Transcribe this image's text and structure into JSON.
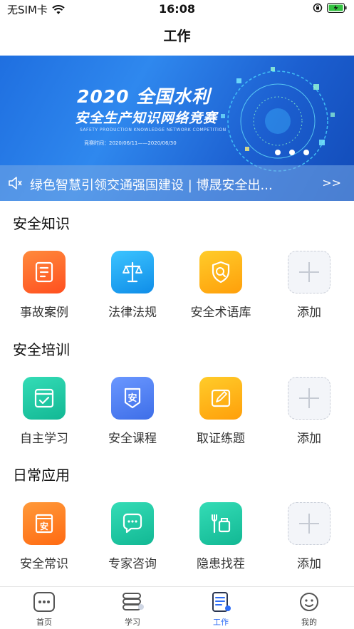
{
  "status": {
    "carrier": "无SIM卡",
    "time": "16:08"
  },
  "nav": {
    "title": "工作"
  },
  "banner": {
    "title1": "2020 全国水利",
    "title2": "安全生产知识网络竞赛",
    "subtitle": "SAFETY PRODUCTION KNOWLEDGE NETWORK COMPETITION",
    "date": "竞赛时间：2020/06/11——2020/06/30",
    "active_dot": 0,
    "dot_count": 3
  },
  "notice": {
    "text": "绿色智慧引领交通强国建设 | 博晟安全出...",
    "more": ">>"
  },
  "sections": [
    {
      "title": "安全知识",
      "items": [
        {
          "label": "事故案例",
          "icon": "case-file-icon",
          "color": "#ff6a2b"
        },
        {
          "label": "法律法规",
          "icon": "scales-icon",
          "color": "#1fa8f0"
        },
        {
          "label": "安全术语库",
          "icon": "search-shield-icon",
          "color": "#ffb514"
        },
        {
          "label": "添加",
          "icon": "plus-icon",
          "color": "#f3f5f9"
        }
      ]
    },
    {
      "title": "安全培训",
      "items": [
        {
          "label": "自主学习",
          "icon": "self-study-icon",
          "color": "#1ec9a6"
        },
        {
          "label": "安全课程",
          "icon": "course-shield-icon",
          "color": "#4a7df0"
        },
        {
          "label": "取证练题",
          "icon": "exam-edit-icon",
          "color": "#ffb514"
        },
        {
          "label": "添加",
          "icon": "plus-icon",
          "color": "#f3f5f9"
        }
      ]
    },
    {
      "title": "日常应用",
      "items": [
        {
          "label": "安全常识",
          "icon": "safety-knowledge-icon",
          "color": "#ff7a1f"
        },
        {
          "label": "专家咨询",
          "icon": "chat-bubble-icon",
          "color": "#1ec9a6"
        },
        {
          "label": "隐患找茬",
          "icon": "wrench-tools-icon",
          "color": "#1ec9a6"
        },
        {
          "label": "添加",
          "icon": "plus-icon",
          "color": "#f3f5f9"
        }
      ]
    }
  ],
  "tabs": [
    {
      "label": "首页",
      "icon": "home-dots-icon",
      "active": false
    },
    {
      "label": "学习",
      "icon": "study-book-icon",
      "active": false
    },
    {
      "label": "工作",
      "icon": "work-doc-icon",
      "active": true
    },
    {
      "label": "我的",
      "icon": "profile-icon",
      "active": false
    }
  ],
  "colors": {
    "accent": "#2e6df6",
    "banner_blue": "#1f6fe0"
  }
}
